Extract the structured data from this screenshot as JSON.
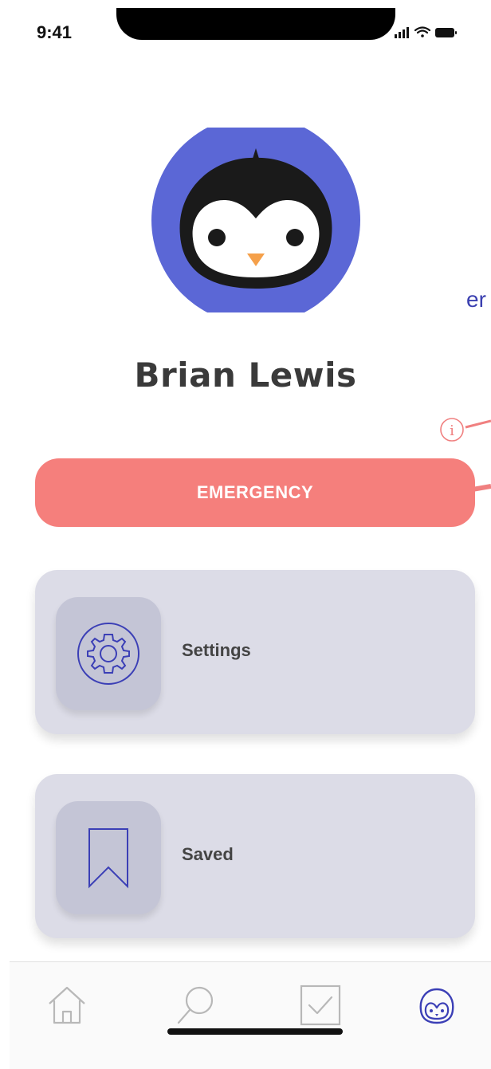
{
  "status_bar": {
    "time": "9:41"
  },
  "profile": {
    "name": "Brian Lewis",
    "avatar_icon": "penguin-avatar-icon"
  },
  "annotation": {
    "text_fragment": "er",
    "icon": "info-icon",
    "color": "#f08080"
  },
  "emergency": {
    "label": "EMERGENCY",
    "color": "#f57f7c"
  },
  "menu": {
    "items": [
      {
        "label": "Settings",
        "icon": "gear-icon"
      },
      {
        "label": "Saved",
        "icon": "bookmark-icon"
      }
    ]
  },
  "bottom_nav": {
    "items": [
      {
        "icon": "home-icon",
        "active": false
      },
      {
        "icon": "search-icon",
        "active": false
      },
      {
        "icon": "checkbox-icon",
        "active": false
      },
      {
        "icon": "penguin-icon",
        "active": true
      }
    ],
    "active_color": "#3b3fb6",
    "inactive_color": "#b8b8b8"
  },
  "colors": {
    "accent": "#5b67d6",
    "card_bg": "#dcdce7",
    "icon_box_bg": "#c4c5d6",
    "icon_stroke": "#3b3fb6"
  }
}
